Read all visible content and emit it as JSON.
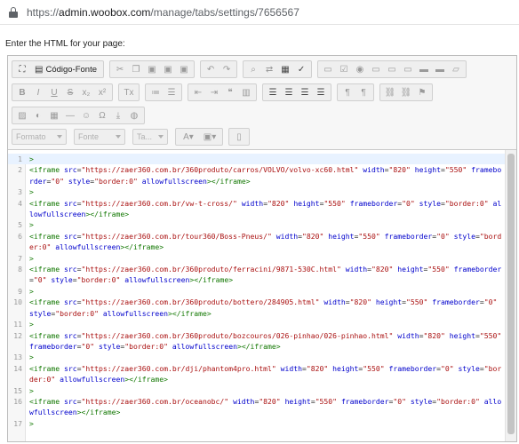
{
  "browser": {
    "url_prefix": "https://",
    "url_host": "admin.woobox.com",
    "url_path": "/manage/tabs/settings/7656567"
  },
  "prompt_label": "Enter the HTML for your page:",
  "toolbar": {
    "source_label": "Código-Fonte",
    "combos": [
      "Formato",
      "Fonte",
      "Ta..."
    ]
  },
  "code_lines": [
    {
      "n": "1",
      "text": ">"
    },
    {
      "n": "2",
      "text": "<iframe src=\"https://zaer360.com.br/360produto/carros/VOLVO/volvo-xc60.html\" width=\"820\" height=\"550\" frameborder=\"0\" style=\"border:0\" allowfullscreen></iframe>"
    },
    {
      "n": "3",
      "text": ">"
    },
    {
      "n": "4",
      "text": "<iframe src=\"https://zaer360.com.br/vw-t-cross/\" width=\"820\" height=\"550\" frameborder=\"0\" style=\"border:0\" allowfullscreen></iframe>"
    },
    {
      "n": "5",
      "text": ">"
    },
    {
      "n": "6",
      "text": "<iframe src=\"https://zaer360.com.br/tour360/Boss-Pneus/\" width=\"820\" height=\"550\" frameborder=\"0\" style=\"border:0\" allowfullscreen></iframe>"
    },
    {
      "n": "7",
      "text": ">"
    },
    {
      "n": "8",
      "text": "<iframe src=\"https://zaer360.com.br/360produto/ferracini/9871-530C.html\" width=\"820\" height=\"550\" frameborder=\"0\" style=\"border:0\" allowfullscreen></iframe>"
    },
    {
      "n": "9",
      "text": ">"
    },
    {
      "n": "10",
      "text": "<iframe src=\"https://zaer360.com.br/360produto/bottero/284905.html\" width=\"820\" height=\"550\" frameborder=\"0\" style=\"border:0\" allowfullscreen></iframe>"
    },
    {
      "n": "11",
      "text": ">"
    },
    {
      "n": "12",
      "text": "<iframe src=\"https://zaer360.com.br/360produto/bozcouros/026-pinhao/026-pinhao.html\" width=\"820\" height=\"550\" frameborder=\"0\" style=\"border:0\" allowfullscreen></iframe>"
    },
    {
      "n": "13",
      "text": ">"
    },
    {
      "n": "14",
      "text": "<iframe src=\"https://zaer360.com.br/dji/phantom4pro.html\" width=\"820\" height=\"550\" frameborder=\"0\" style=\"border:0\" allowfullscreen></iframe>"
    },
    {
      "n": "15",
      "text": ">"
    },
    {
      "n": "16",
      "text": "<iframe src=\"https://zaer360.com.br/oceanobc/\" width=\"820\" height=\"550\" frameborder=\"0\" style=\"border:0\" allowfullscreen></iframe>"
    },
    {
      "n": "17",
      "text": ">"
    }
  ]
}
